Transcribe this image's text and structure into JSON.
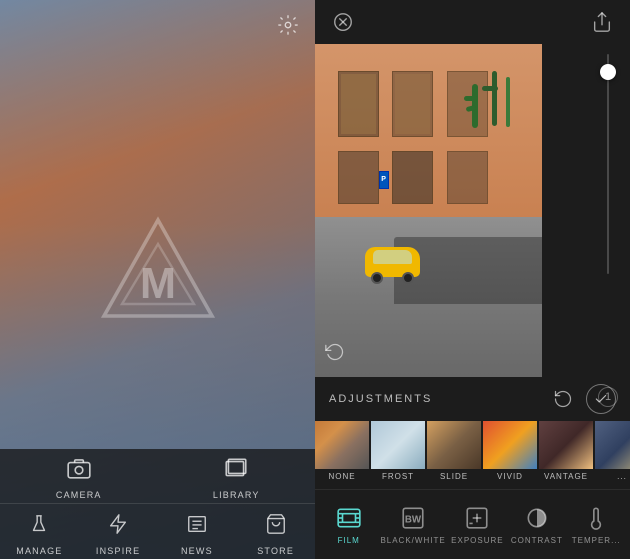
{
  "left": {
    "settings_label": "settings",
    "logo": "M",
    "nav_top": [
      {
        "id": "camera",
        "label": "CAMERA",
        "icon": "camera"
      },
      {
        "id": "library",
        "label": "LIBRARY",
        "icon": "library"
      }
    ],
    "nav_bottom": [
      {
        "id": "manage",
        "label": "MANAGE",
        "icon": "flask"
      },
      {
        "id": "inspire",
        "label": "INSPIRE",
        "icon": "lightning"
      },
      {
        "id": "news",
        "label": "NEWS",
        "icon": "newspaper"
      },
      {
        "id": "store",
        "label": "STORE",
        "icon": "cart"
      }
    ]
  },
  "right": {
    "close_label": "close",
    "share_label": "share",
    "adjustments_label": "ADJUSTMENTS",
    "undo_label": "undo",
    "confirm_label": "confirm",
    "slider_value": "1",
    "filters": [
      {
        "id": "none",
        "label": "NONE",
        "active": false
      },
      {
        "id": "frost",
        "label": "FROST",
        "active": false
      },
      {
        "id": "slide",
        "label": "SLIDE",
        "active": false
      },
      {
        "id": "vivid",
        "label": "VIVID",
        "active": false
      },
      {
        "id": "vantage",
        "label": "VANTAGE",
        "active": false
      },
      {
        "id": "extra",
        "label": "...",
        "active": false
      }
    ],
    "tools": [
      {
        "id": "film",
        "label": "FILM",
        "active": true
      },
      {
        "id": "bw",
        "label": "BLACK/WHITE",
        "active": false
      },
      {
        "id": "exposure",
        "label": "EXPOSURE",
        "active": false
      },
      {
        "id": "contrast",
        "label": "CONTRAST",
        "active": false
      },
      {
        "id": "temperature",
        "label": "TEMPER...",
        "active": false
      }
    ]
  }
}
